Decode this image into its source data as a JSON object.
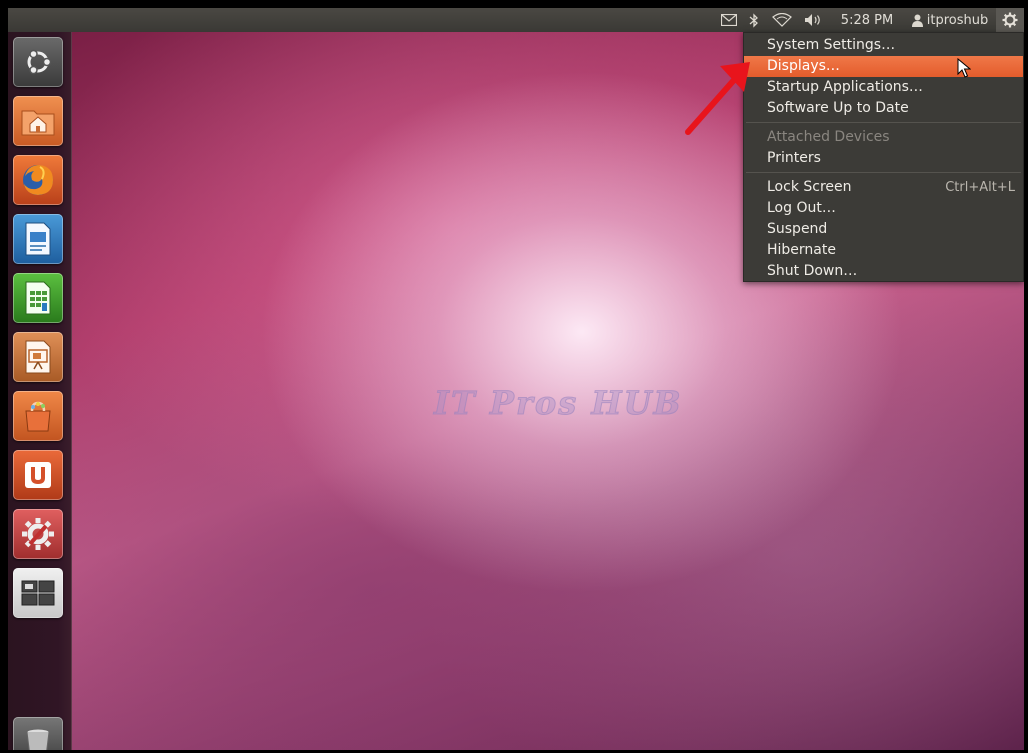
{
  "panel": {
    "clock": "5:28 PM",
    "user": "itproshub",
    "indicators": [
      "mail-icon",
      "bluetooth-icon",
      "wifi-icon",
      "volume-icon",
      "user-icon",
      "gear-icon"
    ]
  },
  "launcher": {
    "items": [
      {
        "name": "ubuntu-logo-icon",
        "color": "#5e5e5e"
      },
      {
        "name": "home-folder-icon",
        "color": "#e07030"
      },
      {
        "name": "firefox-icon",
        "color": "#d2501f"
      },
      {
        "name": "writer-icon",
        "color": "#2b7ec1"
      },
      {
        "name": "calc-icon",
        "color": "#3f9a2a"
      },
      {
        "name": "impress-icon",
        "color": "#c8743a"
      },
      {
        "name": "software-center-icon",
        "color": "#e0672a"
      },
      {
        "name": "ubuntu-one-icon",
        "color": "#d5502a"
      },
      {
        "name": "system-settings-icon",
        "color": "#c84848"
      },
      {
        "name": "workspace-switcher-icon",
        "color": "#d8d8d8"
      },
      {
        "name": "trash-icon",
        "color": "#555555"
      }
    ]
  },
  "menu": {
    "items": [
      {
        "label": "System Settings…"
      },
      {
        "label": "Displays…",
        "highlighted": true
      },
      {
        "label": "Startup Applications…"
      },
      {
        "label": "Software Up to Date"
      },
      {
        "label": "Attached Devices",
        "disabled": true
      },
      {
        "label": "Printers"
      },
      {
        "label": "Lock Screen",
        "accel": "Ctrl+Alt+L"
      },
      {
        "label": "Log Out…"
      },
      {
        "label": "Suspend"
      },
      {
        "label": "Hibernate"
      },
      {
        "label": "Shut Down…"
      }
    ]
  },
  "watermark": "IT Pros HUB",
  "accent": "#e8602f"
}
